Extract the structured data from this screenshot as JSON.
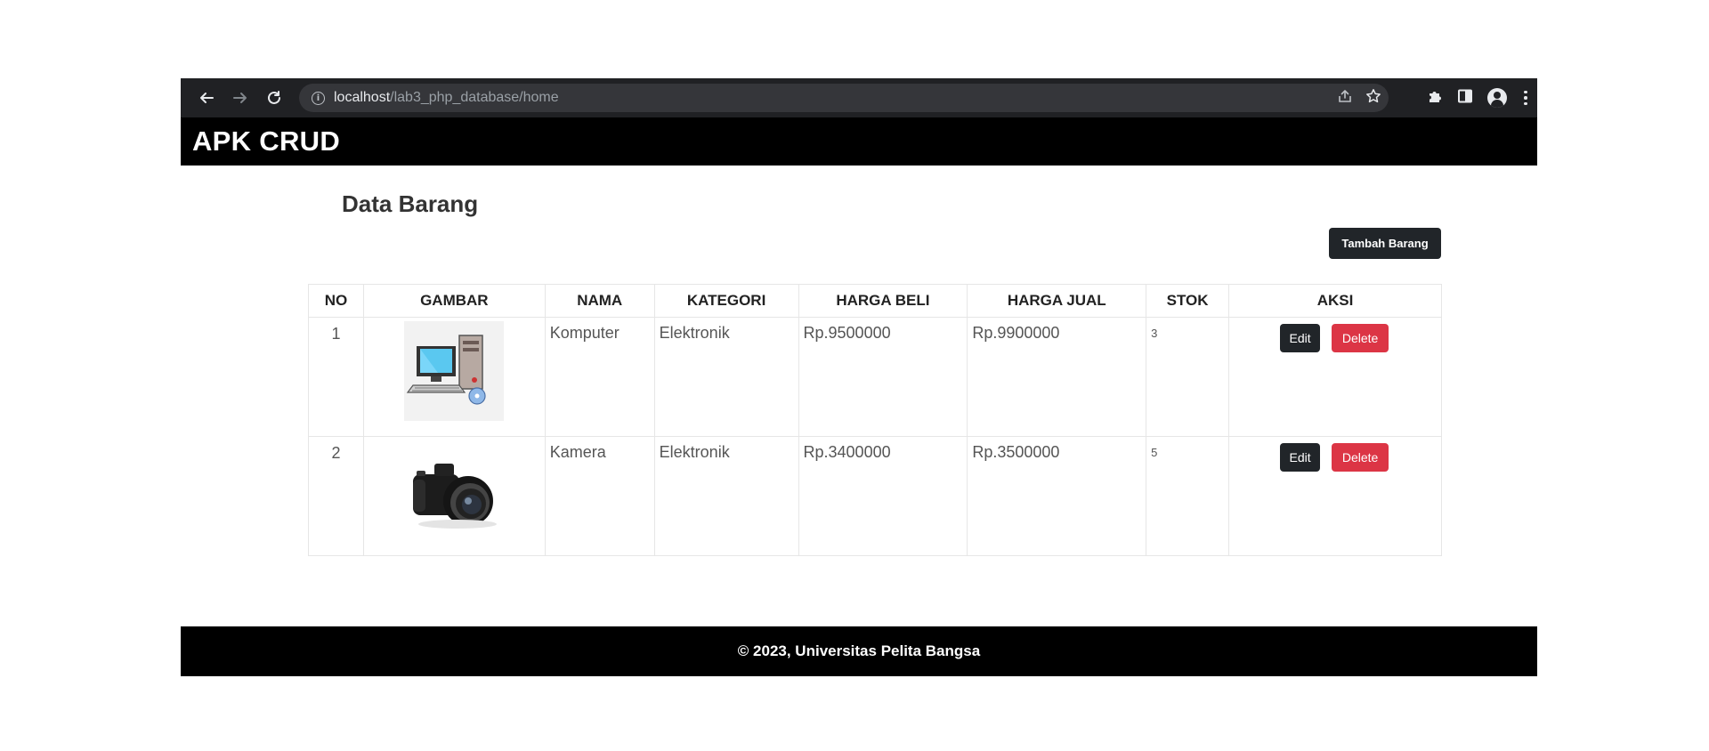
{
  "browser": {
    "url_host": "localhost",
    "url_path": "/lab3_php_database/home"
  },
  "navbar": {
    "brand": "APK CRUD"
  },
  "main": {
    "title": "Data Barang",
    "add_button": "Tambah Barang"
  },
  "table": {
    "headers": [
      "NO",
      "GAMBAR",
      "NAMA",
      "KATEGORI",
      "HARGA BELI",
      "HARGA JUAL",
      "STOK",
      "AKSI"
    ],
    "rows": [
      {
        "no": "1",
        "image": "computer-image",
        "nama": "Komputer",
        "kategori": "Elektronik",
        "harga_beli": "Rp.9500000",
        "harga_jual": "Rp.9900000",
        "stok": "3",
        "edit": "Edit",
        "delete": "Delete"
      },
      {
        "no": "2",
        "image": "camera-image",
        "nama": "Kamera",
        "kategori": "Elektronik",
        "harga_beli": "Rp.3400000",
        "harga_jual": "Rp.3500000",
        "stok": "5",
        "edit": "Edit",
        "delete": "Delete"
      }
    ]
  },
  "footer": {
    "text": "© 2023, Universitas Pelita Bangsa"
  },
  "colors": {
    "chrome_bg": "#202124",
    "navbar_bg": "#000000",
    "button_dark": "#212529",
    "button_danger": "#dc3545"
  }
}
